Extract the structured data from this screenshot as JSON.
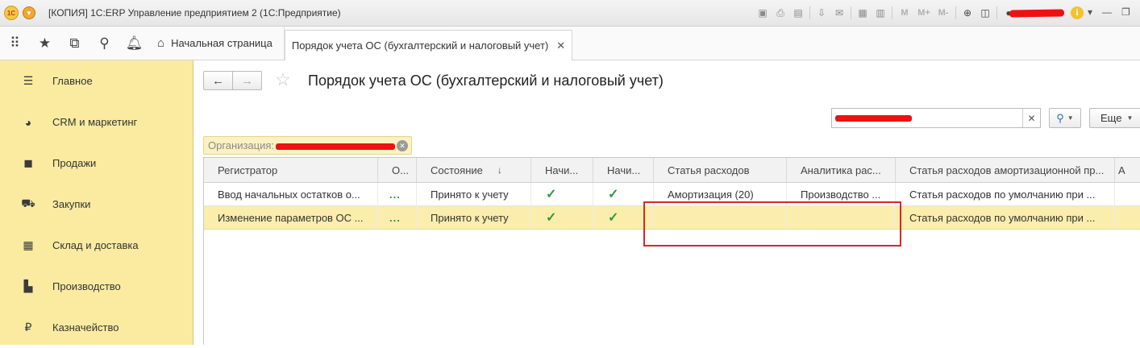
{
  "titlebar": {
    "title": "[КОПИЯ] 1С:ERP Управление предприятием 2  (1С:Предприятие)",
    "logo": "1С",
    "m_labels": [
      "M",
      "M+",
      "M-"
    ]
  },
  "tabs": {
    "home": "Начальная страница",
    "active": "Порядок учета ОС (бухгалтерский и налоговый учет)"
  },
  "sidebar": {
    "items": [
      {
        "label": "Главное",
        "icon": "menu-icon"
      },
      {
        "label": "CRM и маркетинг",
        "icon": "pie-chart-icon"
      },
      {
        "label": "Продажи",
        "icon": "shopping-bag-icon"
      },
      {
        "label": "Закупки",
        "icon": "cart-icon"
      },
      {
        "label": "Склад и доставка",
        "icon": "warehouse-grid-icon"
      },
      {
        "label": "Производство",
        "icon": "factory-icon"
      },
      {
        "label": "Казначейство",
        "icon": "ruble-icon"
      }
    ]
  },
  "page": {
    "title": "Порядок учета ОС (бухгалтерский и налоговый учет)",
    "more_label": "Еще",
    "org_filter_label": "Организация:"
  },
  "table": {
    "headers": [
      "Регистратор",
      "О...",
      "Состояние",
      "Начи...",
      "Начи...",
      "Статья расходов",
      "Аналитика рас...",
      "Статья расходов амортизационной пр...",
      "А"
    ],
    "rows": [
      [
        "Ввод начальных остатков о...",
        "...",
        "Принято к учету",
        "✓",
        "✓",
        "Амортизация (20)",
        "Производство ...",
        "Статья расходов по умолчанию при ...",
        ""
      ],
      [
        "Изменение параметров ОС ...",
        "...",
        "Принято к учету",
        "✓",
        "✓",
        "",
        "",
        "Статья расходов по умолчанию при ...",
        ""
      ]
    ]
  },
  "colors": {
    "sidebar_bg": "#faeba0",
    "selected_row": "#fbedac",
    "highlight_rect": "#d72727",
    "check": "#2f9a3a"
  }
}
